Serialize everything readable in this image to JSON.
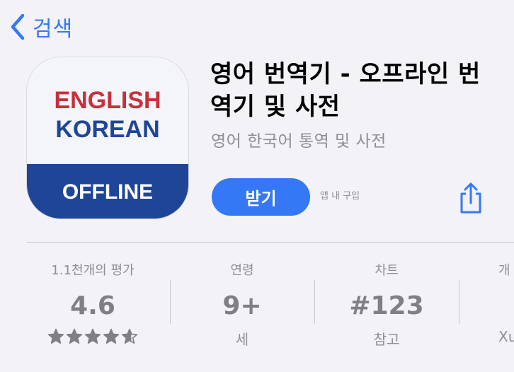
{
  "nav": {
    "back_label": "검색"
  },
  "app": {
    "icon_words": {
      "english": "ENGLISH",
      "korean": "KOREAN",
      "offline": "OFFLINE"
    },
    "title": "영어 번역기 - 오프라인 번역기 및 사전",
    "subtitle": "영어 한국어 통역 및 사전",
    "get_label": "받기",
    "iap_note": "앱 내 구입"
  },
  "stats": [
    {
      "label": "1.1천개의 평가",
      "value": "4.6",
      "stars": 4.6
    },
    {
      "label": "연령",
      "value": "9+",
      "sub": "세"
    },
    {
      "label": "차트",
      "value": "#123",
      "sub": "참고"
    }
  ],
  "edge": {
    "label": "개",
    "sub": "Xu"
  },
  "colors": {
    "accent": "#3478f6",
    "icon_red": "#c6313c",
    "icon_blue": "#1f4696",
    "secondary": "#8e8e93"
  }
}
